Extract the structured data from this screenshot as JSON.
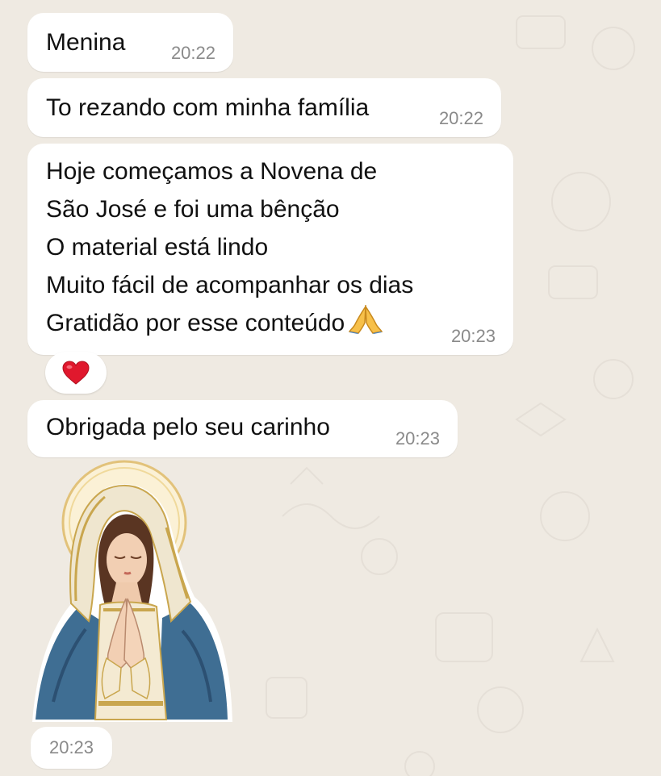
{
  "chat": {
    "messages": [
      {
        "text": "Menina",
        "time": "20:22"
      },
      {
        "text": "To rezando com minha família",
        "time": "20:22"
      },
      {
        "text": "Hoje começamos a Novena de\nSão José e foi uma bênção\nO material está lindo\nMuito fácil de acompanhar os dias\nGratidão por esse conteúdo",
        "emoji": "praying-hands-icon",
        "time": "20:23"
      },
      {
        "text": "Obrigada pelo seu carinho",
        "time": "20:23"
      }
    ],
    "reaction": {
      "icon": "red-heart-icon"
    },
    "sticker": {
      "subject": "praying-virgin-mary-sticker",
      "time": "20:23"
    }
  },
  "colors": {
    "background": "#efeae2",
    "bubble": "#ffffff",
    "timestamp": "#8a8a8a",
    "heart": "#e0182d"
  }
}
